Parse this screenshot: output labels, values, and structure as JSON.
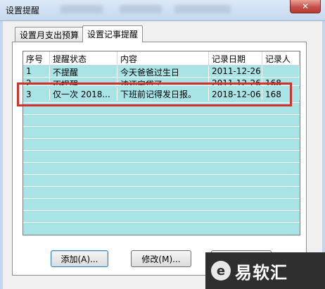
{
  "window": {
    "title": "设置提醒",
    "close_label": "✕"
  },
  "tabs": [
    {
      "label": "设置月支出预算",
      "active": false
    },
    {
      "label": "设置记事提醒",
      "active": true
    }
  ],
  "list": {
    "columns": [
      "序号",
      "提醒状态",
      "内容",
      "记录日期",
      "记录人"
    ],
    "rows": [
      [
        "1",
        "不提醒",
        "今天爸爸过生日",
        "2011-12-26",
        ""
      ],
      [
        "2",
        "不提醒",
        "该还房贷了",
        "2011-12-26",
        "168"
      ],
      [
        "3",
        "仅一次 2018...",
        "下班前记得发日报。",
        "2018-12-06",
        "168"
      ]
    ],
    "highlighted_row": 3,
    "background": "#a8e3e6",
    "highlight_color": "#d0322c"
  },
  "buttons": {
    "add": "添加(A)...",
    "edit": "修改(M)..."
  },
  "watermark": {
    "text": "易软汇",
    "icon": "e-logo-icon"
  }
}
